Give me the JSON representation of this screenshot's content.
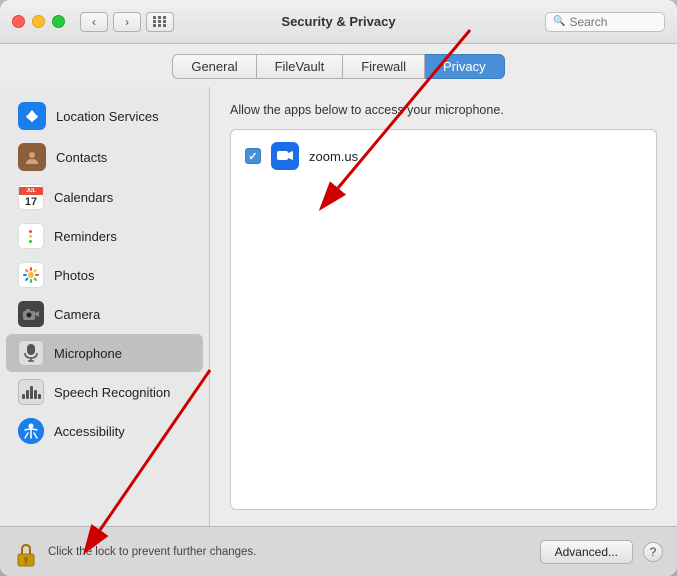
{
  "window": {
    "title": "Security & Privacy"
  },
  "titlebar": {
    "back_label": "‹",
    "forward_label": "›",
    "search_placeholder": "Search"
  },
  "tabs": [
    {
      "id": "general",
      "label": "General",
      "active": false
    },
    {
      "id": "filevault",
      "label": "FileVault",
      "active": false
    },
    {
      "id": "firewall",
      "label": "Firewall",
      "active": false
    },
    {
      "id": "privacy",
      "label": "Privacy",
      "active": true
    }
  ],
  "sidebar": {
    "items": [
      {
        "id": "location-services",
        "label": "Location Services",
        "icon": "location"
      },
      {
        "id": "contacts",
        "label": "Contacts",
        "icon": "contacts"
      },
      {
        "id": "calendars",
        "label": "Calendars",
        "icon": "calendars"
      },
      {
        "id": "reminders",
        "label": "Reminders",
        "icon": "reminders"
      },
      {
        "id": "photos",
        "label": "Photos",
        "icon": "photos"
      },
      {
        "id": "camera",
        "label": "Camera",
        "icon": "camera"
      },
      {
        "id": "microphone",
        "label": "Microphone",
        "icon": "microphone",
        "active": true
      },
      {
        "id": "speech-recognition",
        "label": "Speech Recognition",
        "icon": "speech"
      },
      {
        "id": "accessibility",
        "label": "Accessibility",
        "icon": "accessibility"
      }
    ]
  },
  "panel": {
    "description": "Allow the apps below to access your microphone.",
    "apps": [
      {
        "id": "zoom",
        "label": "zoom.us",
        "checked": true
      }
    ]
  },
  "bottom_bar": {
    "lock_text": "Click the lock to prevent further changes.",
    "advanced_label": "Advanced...",
    "help_label": "?"
  }
}
